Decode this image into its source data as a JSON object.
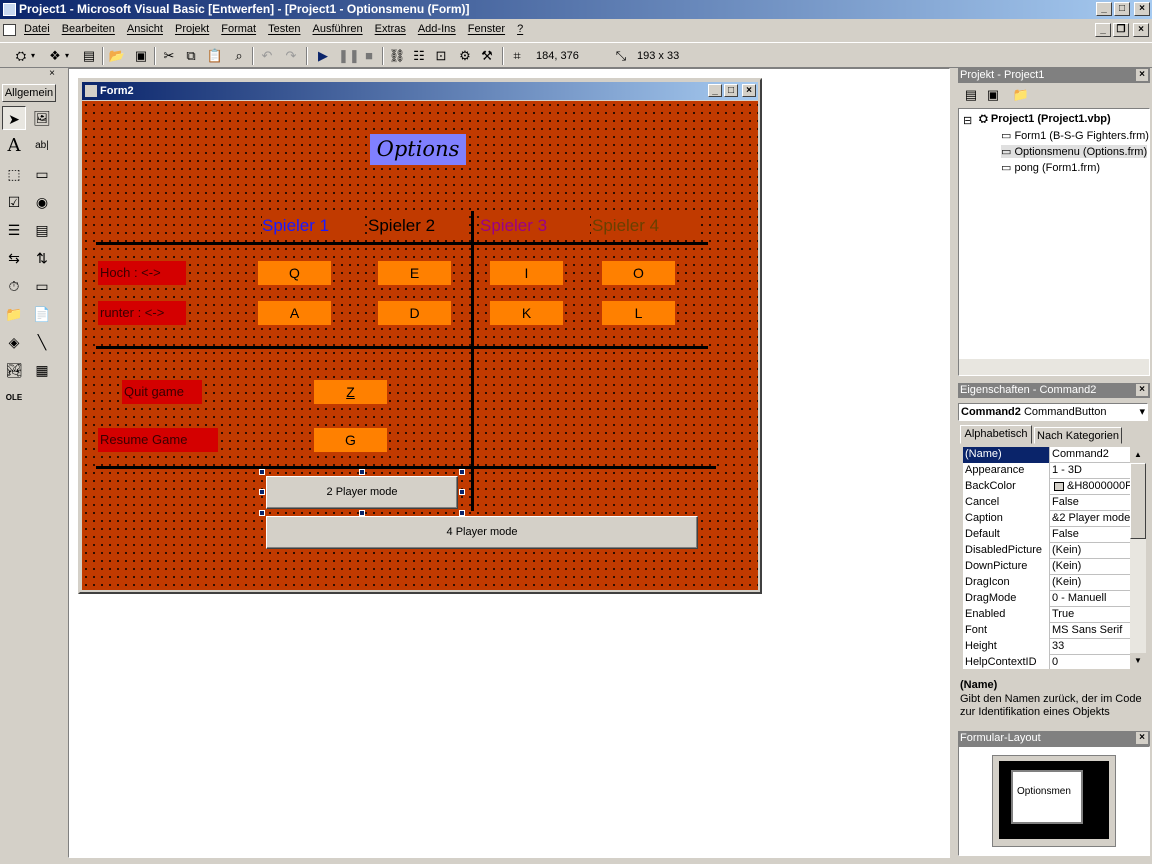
{
  "window": {
    "title": "Project1 - Microsoft Visual Basic [Entwerfen] - [Project1 - Optionsmenu (Form)]"
  },
  "menu": {
    "items": [
      "Datei",
      "Bearbeiten",
      "Ansicht",
      "Projekt",
      "Format",
      "Testen",
      "Ausführen",
      "Extras",
      "Add-Ins",
      "Fenster",
      "?"
    ]
  },
  "toolbar": {
    "position": "184, 376",
    "size": "193 x 33"
  },
  "toolbox": {
    "tab_label": "Allgemein"
  },
  "form": {
    "title": "Form2",
    "options_label": "Options",
    "players": [
      {
        "label": "Spieler 1",
        "color": "#1a1aff"
      },
      {
        "label": "Spieler 2",
        "color": "#000000"
      },
      {
        "label": "Spieler 3",
        "color": "#9a0088"
      },
      {
        "label": "Spieler 4",
        "color": "#6a4000"
      }
    ],
    "row_labels": {
      "up": "Hoch : <->",
      "down": "runter : <->",
      "quit": "Quit game",
      "resume": "Resume Game"
    },
    "keys_up": [
      "Q",
      "E",
      "I",
      "O"
    ],
    "keys_down": [
      "A",
      "D",
      "K",
      "L"
    ],
    "key_quit": "Z",
    "key_resume": "G",
    "btn_2player": "2 Player mode",
    "btn_4player": "4 Player mode",
    "colors": {
      "background": "#c13a00",
      "key_box": "#ff8000",
      "label_box": "#d40000",
      "options_bg": "#8080ff"
    }
  },
  "project_panel": {
    "title": "Projekt - Project1",
    "root": "Project1 (Project1.vbp)",
    "items": [
      "Form1 (B-S-G Fighters.frm)",
      "Optionsmenu (Options.frm)",
      "pong (Form1.frm)"
    ]
  },
  "properties_panel": {
    "title": "Eigenschaften - Command2",
    "object_name": "Command2",
    "object_type": "CommandButton",
    "tabs": [
      "Alphabetisch",
      "Nach Kategorien"
    ],
    "rows": [
      {
        "name": "(Name)",
        "value": "Command2"
      },
      {
        "name": "Appearance",
        "value": "1 - 3D"
      },
      {
        "name": "BackColor",
        "value": "&H8000000F"
      },
      {
        "name": "Cancel",
        "value": "False"
      },
      {
        "name": "Caption",
        "value": "&2 Player mode"
      },
      {
        "name": "Default",
        "value": "False"
      },
      {
        "name": "DisabledPicture",
        "value": "(Kein)"
      },
      {
        "name": "DownPicture",
        "value": "(Kein)"
      },
      {
        "name": "DragIcon",
        "value": "(Kein)"
      },
      {
        "name": "DragMode",
        "value": "0 - Manuell"
      },
      {
        "name": "Enabled",
        "value": "True"
      },
      {
        "name": "Font",
        "value": "MS Sans Serif"
      },
      {
        "name": "Height",
        "value": "33"
      },
      {
        "name": "HelpContextID",
        "value": "0"
      }
    ],
    "desc_title": "(Name)",
    "desc_text": "Gibt den Namen zurück, der im Code zur Identifikation eines Objekts"
  },
  "layout_panel": {
    "title": "Formular-Layout",
    "preview_label": "Optionsmen"
  }
}
